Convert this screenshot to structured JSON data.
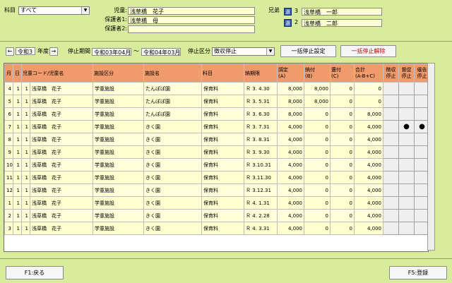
{
  "header": {
    "subject_label": "科目",
    "subject_value": "すべて",
    "child_label": "児童:",
    "child_value": "浅草橋　花子",
    "guardian1_label": "保護者1:",
    "guardian1_value": "浅草橋　母",
    "guardian2_label": "保護者2:",
    "guardian2_value": "",
    "siblings_label": "兄弟",
    "siblings": [
      {
        "select": "選",
        "no": "3",
        "name": "浅草橋　一郎"
      },
      {
        "select": "選",
        "no": "2",
        "name": "浅草橋　二郎"
      }
    ]
  },
  "controls": {
    "prev": "←",
    "next": "→",
    "year": "令和3",
    "year_suffix": "年度",
    "stop_period_label": "停止期間",
    "period_from": "令和03年04月",
    "period_tilde": "～",
    "period_to": "令和04年03月",
    "stop_type_label": "停止区分",
    "stop_type_value": "徴収停止",
    "bulk_set": "一括停止設定",
    "bulk_clear": "一括停止解除"
  },
  "table": {
    "headers": [
      "月",
      "日",
      "児童コード/児童名",
      "施設区分",
      "施設名",
      "科目",
      "納期限",
      "調定\n(A)",
      "納付\n(B)",
      "還付\n(C)",
      "合計\n(A-B+C)",
      "徴収\n停止",
      "督促\n停止",
      "催告\n停止"
    ],
    "rows": [
      {
        "m": "4",
        "d": "1",
        "code": "1",
        "name": "浅草橋　花子",
        "kubun": "学童施設",
        "facility": "たんぽぽ園",
        "subject": "保育料",
        "due": "Ｒ 3. 4.30",
        "a": "8,000",
        "b": "8,000",
        "c": "0",
        "total": "0",
        "s1": "",
        "s2": "",
        "s3": ""
      },
      {
        "m": "5",
        "d": "1",
        "code": "1",
        "name": "浅草橋　花子",
        "kubun": "学童施設",
        "facility": "たんぽぽ園",
        "subject": "保育料",
        "due": "Ｒ 3. 5.31",
        "a": "8,000",
        "b": "8,000",
        "c": "0",
        "total": "0",
        "s1": "",
        "s2": "",
        "s3": ""
      },
      {
        "m": "6",
        "d": "1",
        "code": "1",
        "name": "浅草橋　花子",
        "kubun": "学童施設",
        "facility": "たんぽぽ園",
        "subject": "保育料",
        "due": "Ｒ 3. 6.30",
        "a": "8,000",
        "b": "0",
        "c": "0",
        "total": "8,000",
        "s1": "",
        "s2": "",
        "s3": ""
      },
      {
        "m": "7",
        "d": "1",
        "code": "1",
        "name": "浅草橋　花子",
        "kubun": "学童施設",
        "facility": "きく園",
        "subject": "保育料",
        "due": "Ｒ 3. 7.31",
        "a": "4,000",
        "b": "0",
        "c": "0",
        "total": "4,000",
        "s1": "",
        "s2": "●",
        "s3": "●"
      },
      {
        "m": "8",
        "d": "1",
        "code": "1",
        "name": "浅草橋　花子",
        "kubun": "学童施設",
        "facility": "きく園",
        "subject": "保育料",
        "due": "Ｒ 3. 8.31",
        "a": "4,000",
        "b": "0",
        "c": "0",
        "total": "4,000",
        "s1": "",
        "s2": "",
        "s3": ""
      },
      {
        "m": "9",
        "d": "1",
        "code": "1",
        "name": "浅草橋　花子",
        "kubun": "学童施設",
        "facility": "きく園",
        "subject": "保育料",
        "due": "Ｒ 3. 9.30",
        "a": "4,000",
        "b": "0",
        "c": "0",
        "total": "4,000",
        "s1": "",
        "s2": "",
        "s3": ""
      },
      {
        "m": "10",
        "d": "1",
        "code": "1",
        "name": "浅草橋　花子",
        "kubun": "学童施設",
        "facility": "きく園",
        "subject": "保育料",
        "due": "Ｒ 3.10.31",
        "a": "4,000",
        "b": "0",
        "c": "0",
        "total": "4,000",
        "s1": "",
        "s2": "",
        "s3": ""
      },
      {
        "m": "11",
        "d": "1",
        "code": "1",
        "name": "浅草橋　花子",
        "kubun": "学童施設",
        "facility": "きく園",
        "subject": "保育料",
        "due": "Ｒ 3.11.30",
        "a": "4,000",
        "b": "0",
        "c": "0",
        "total": "4,000",
        "s1": "",
        "s2": "",
        "s3": ""
      },
      {
        "m": "12",
        "d": "1",
        "code": "1",
        "name": "浅草橋　花子",
        "kubun": "学童施設",
        "facility": "きく園",
        "subject": "保育料",
        "due": "Ｒ 3.12.31",
        "a": "4,000",
        "b": "0",
        "c": "0",
        "total": "4,000",
        "s1": "",
        "s2": "",
        "s3": ""
      },
      {
        "m": "1",
        "d": "1",
        "code": "1",
        "name": "浅草橋　花子",
        "kubun": "学童施設",
        "facility": "きく園",
        "subject": "保育料",
        "due": "Ｒ 4. 1.31",
        "a": "4,000",
        "b": "0",
        "c": "0",
        "total": "4,000",
        "s1": "",
        "s2": "",
        "s3": ""
      },
      {
        "m": "2",
        "d": "1",
        "code": "1",
        "name": "浅草橋　花子",
        "kubun": "学童施設",
        "facility": "きく園",
        "subject": "保育料",
        "due": "Ｒ 4. 2.28",
        "a": "4,000",
        "b": "0",
        "c": "0",
        "total": "4,000",
        "s1": "",
        "s2": "",
        "s3": ""
      },
      {
        "m": "3",
        "d": "1",
        "code": "1",
        "name": "浅草橋　花子",
        "kubun": "学童施設",
        "facility": "きく園",
        "subject": "保育料",
        "due": "Ｒ 4. 3.31",
        "a": "4,000",
        "b": "0",
        "c": "0",
        "total": "4,000",
        "s1": "",
        "s2": "",
        "s3": ""
      }
    ]
  },
  "footer": {
    "back": "F1:戻る",
    "register": "F5:登録"
  }
}
